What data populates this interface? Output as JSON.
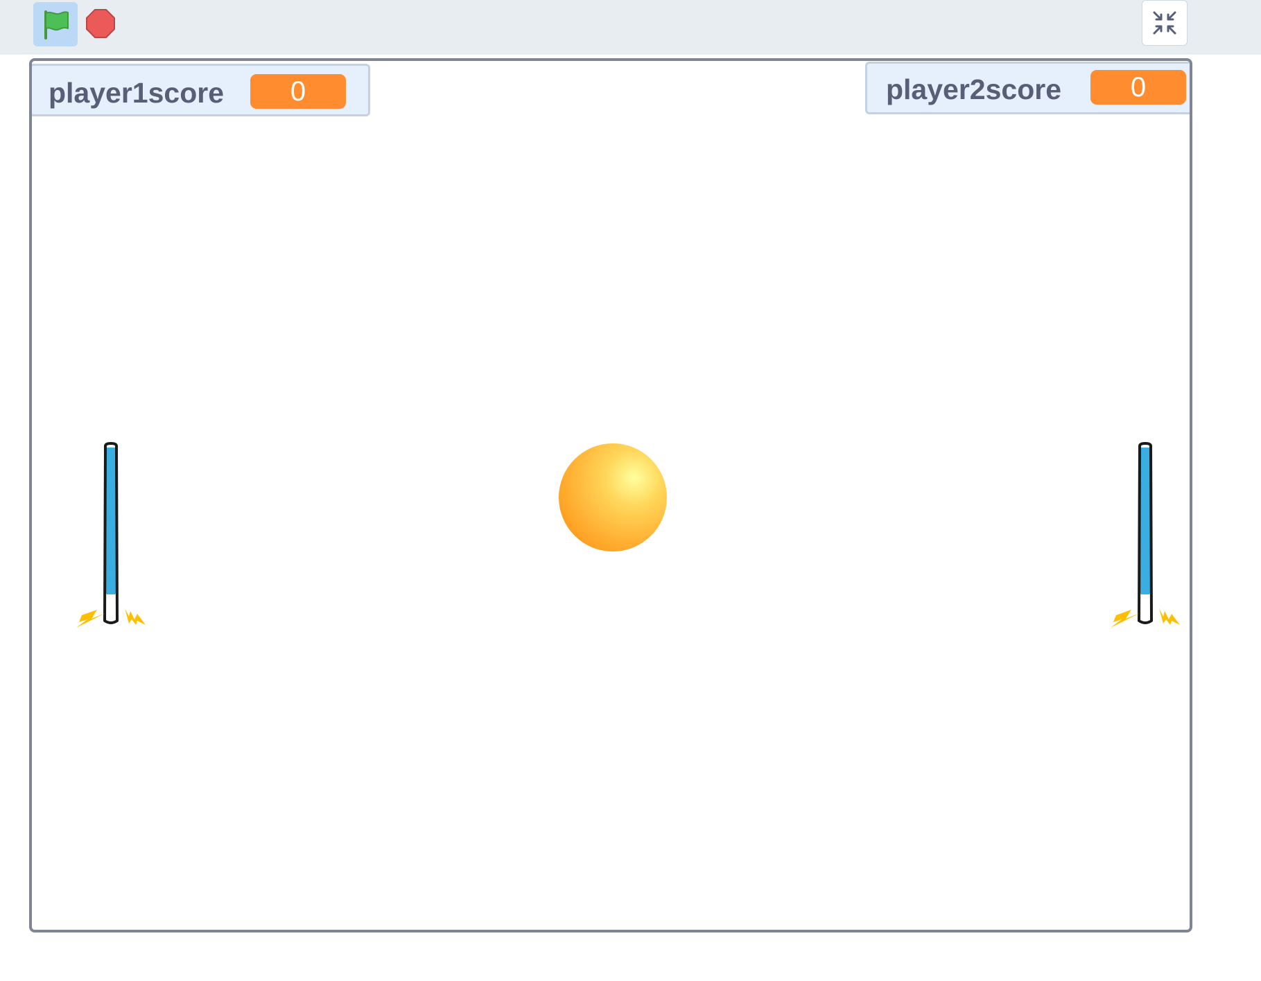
{
  "toolbar": {
    "green_flag_icon": "green-flag-icon",
    "stop_icon": "stop-sign-icon",
    "shrink_icon": "unfullscreen-icon"
  },
  "stage": {
    "monitors": [
      {
        "label": "player1score",
        "value": "0"
      },
      {
        "label": "player2score",
        "value": "0"
      }
    ],
    "sprites": [
      "ball",
      "paddle-left",
      "paddle-right"
    ]
  },
  "colors": {
    "toolbar_bg": "#e8edf2",
    "flag_active_bg": "#bcd8f7",
    "monitor_value_bg": "#ff8c2e",
    "monitor_label": "#575e75",
    "stage_border": "#7f8594",
    "paddle_fill": "#3aaee0",
    "ball": "#ffab2e"
  }
}
